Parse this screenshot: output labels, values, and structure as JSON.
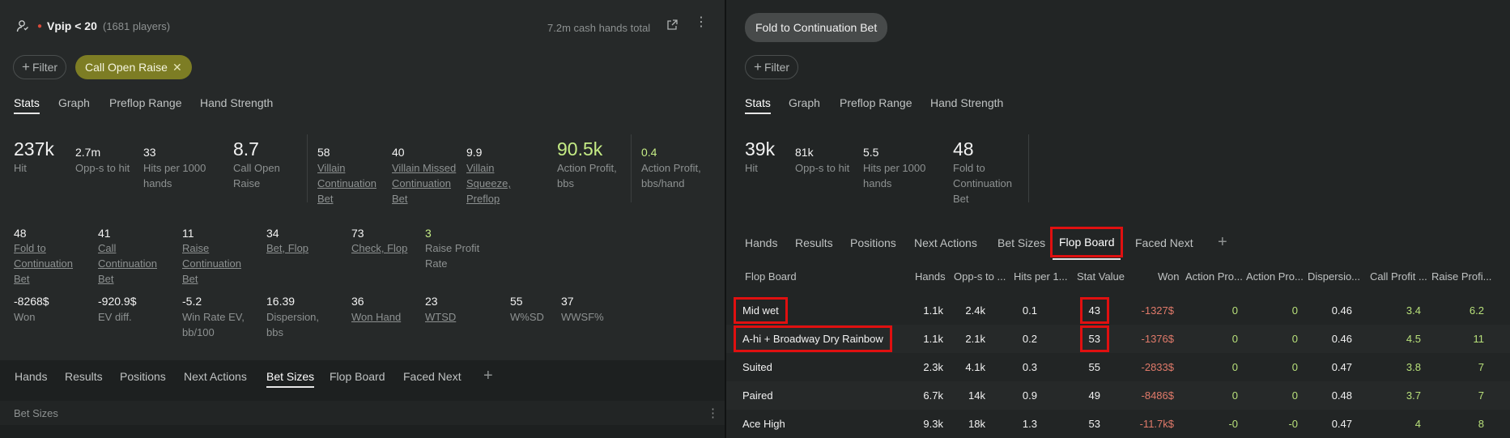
{
  "left": {
    "header": {
      "title": "Vpip < 20",
      "players": "(1681 players)",
      "cash_hands": "7.2m cash hands total"
    },
    "filter_label": "Filter",
    "chip_label": "Call Open Raise",
    "tabs": [
      "Stats",
      "Graph",
      "Preflop Range",
      "Hand Strength"
    ],
    "stats_row1": [
      {
        "value": "237k",
        "label": "Hit"
      },
      {
        "value": "2.7m",
        "label": "Opp-s to hit"
      },
      {
        "value": "33",
        "label": "Hits per 1000 hands"
      },
      {
        "value": "8.7",
        "label": "Call Open Raise"
      },
      {
        "value": "58",
        "label": "Villain Continuation Bet"
      },
      {
        "value": "40",
        "label": "Villain Missed Continuation Bet"
      },
      {
        "value": "9.9",
        "label": "Villain Squeeze, Preflop"
      },
      {
        "value": "90.5k",
        "label": "Action Profit, bbs"
      },
      {
        "value": "0.4",
        "label": "Action Profit, bbs/hand"
      }
    ],
    "stats_row2": [
      {
        "value": "48",
        "label": "Fold to Continuation Bet"
      },
      {
        "value": "41",
        "label": "Call Continuation Bet"
      },
      {
        "value": "11",
        "label": "Raise Continuation Bet"
      },
      {
        "value": "34",
        "label": "Bet, Flop"
      },
      {
        "value": "73",
        "label": "Check, Flop"
      },
      {
        "value": "3",
        "label": "Raise Profit Rate"
      }
    ],
    "stats_row3": [
      {
        "value": "-8268$",
        "label": "Won"
      },
      {
        "value": "-920.9$",
        "label": "EV diff."
      },
      {
        "value": "-5.2",
        "label": "Win Rate EV, bb/100"
      },
      {
        "value": "16.39",
        "label": "Dispersion, bbs"
      },
      {
        "value": "36",
        "label": "Won Hand"
      },
      {
        "value": "23",
        "label": "WTSD"
      },
      {
        "value": "55",
        "label": "W%SD"
      },
      {
        "value": "37",
        "label": "WWSF%"
      }
    ],
    "subtabs": [
      "Hands",
      "Results",
      "Positions",
      "Next Actions",
      "Bet Sizes",
      "Flop Board",
      "Faced Next"
    ],
    "section_label": "Bet Sizes"
  },
  "right": {
    "chip_label": "Fold to Continuation Bet",
    "filter_label": "Filter",
    "tabs": [
      "Stats",
      "Graph",
      "Preflop Range",
      "Hand Strength"
    ],
    "stats": [
      {
        "value": "39k",
        "label": "Hit"
      },
      {
        "value": "81k",
        "label": "Opp-s to hit"
      },
      {
        "value": "5.5",
        "label": "Hits per 1000 hands"
      },
      {
        "value": "48",
        "label": "Fold to Continuation Bet"
      }
    ],
    "subtabs": [
      "Hands",
      "Results",
      "Positions",
      "Next Actions",
      "Bet Sizes",
      "Flop Board",
      "Faced Next"
    ],
    "table": {
      "columns": [
        "Flop Board",
        "Hands",
        "Opp-s to ...",
        "Hits per 1...",
        "Stat Value",
        "Won",
        "Action Pro...",
        "Action Pro...",
        "Dispersio...",
        "Call Profit ...",
        "Raise Profi..."
      ],
      "rows": [
        [
          "Mid wet",
          "1.1k",
          "2.4k",
          "0.1",
          "43",
          "-1327$",
          "0",
          "0",
          "0.46",
          "3.4",
          "6.2"
        ],
        [
          "A-hi + Broadway Dry Rainbow",
          "1.1k",
          "2.1k",
          "0.2",
          "53",
          "-1376$",
          "0",
          "0",
          "0.46",
          "4.5",
          "11"
        ],
        [
          "Suited",
          "2.3k",
          "4.1k",
          "0.3",
          "55",
          "-2833$",
          "0",
          "0",
          "0.47",
          "3.8",
          "7"
        ],
        [
          "Paired",
          "6.7k",
          "14k",
          "0.9",
          "49",
          "-8486$",
          "0",
          "0",
          "0.48",
          "3.7",
          "7"
        ],
        [
          "Ace High",
          "9.3k",
          "18k",
          "1.3",
          "53",
          "-11.7k$",
          "-0",
          "-0",
          "0.47",
          "4",
          "8"
        ]
      ]
    }
  }
}
